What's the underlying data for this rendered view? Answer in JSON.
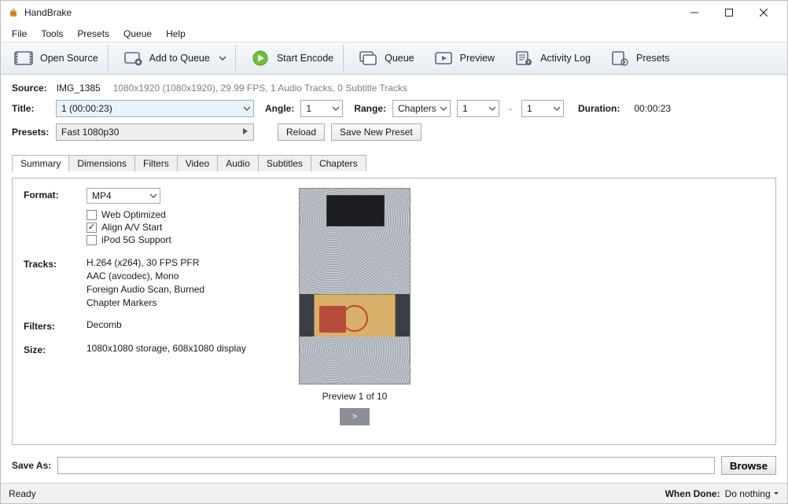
{
  "window": {
    "title": "HandBrake"
  },
  "menus": {
    "file": "File",
    "tools": "Tools",
    "presets": "Presets",
    "queue": "Queue",
    "help": "Help"
  },
  "toolbar": {
    "open_source": "Open Source",
    "add_to_queue": "Add to Queue",
    "start_encode": "Start Encode",
    "queue": "Queue",
    "preview": "Preview",
    "activity_log": "Activity Log",
    "presets": "Presets"
  },
  "source": {
    "label": "Source:",
    "name": "IMG_1385",
    "meta": "1080x1920 (1080x1920), 29.99 FPS, 1 Audio Tracks, 0 Subtitle Tracks"
  },
  "title_row": {
    "title_label": "Title:",
    "title_value": "1 (00:00:23)",
    "angle_label": "Angle:",
    "angle_value": "1",
    "range_label": "Range:",
    "range_type": "Chapters",
    "range_from": "1",
    "range_dash": "-",
    "range_to": "1",
    "duration_label": "Duration:",
    "duration_value": "00:00:23"
  },
  "presets_row": {
    "label": "Presets:",
    "value": "Fast 1080p30",
    "reload": "Reload",
    "save_new": "Save New Preset"
  },
  "tabs": {
    "summary": "Summary",
    "dimensions": "Dimensions",
    "filters": "Filters",
    "video": "Video",
    "audio": "Audio",
    "subtitles": "Subtitles",
    "chapters": "Chapters"
  },
  "summary": {
    "format_label": "Format:",
    "format_value": "MP4",
    "web_optimized": "Web Optimized",
    "align_av": "Align A/V Start",
    "ipod": "iPod 5G Support",
    "tracks_label": "Tracks:",
    "tracks": {
      "l1": "H.264 (x264), 30 FPS PFR",
      "l2": "AAC (avcodec), Mono",
      "l3": "Foreign Audio Scan, Burned",
      "l4": "Chapter Markers"
    },
    "filters_label": "Filters:",
    "filters_value": "Decomb",
    "size_label": "Size:",
    "size_value": "1080x1080 storage, 608x1080 display",
    "preview_caption": "Preview 1 of 10",
    "next": ">"
  },
  "saveas": {
    "label": "Save As:",
    "value": "",
    "browse": "Browse"
  },
  "status": {
    "ready": "Ready",
    "when_done_label": "When Done:",
    "when_done_value": "Do nothing"
  }
}
